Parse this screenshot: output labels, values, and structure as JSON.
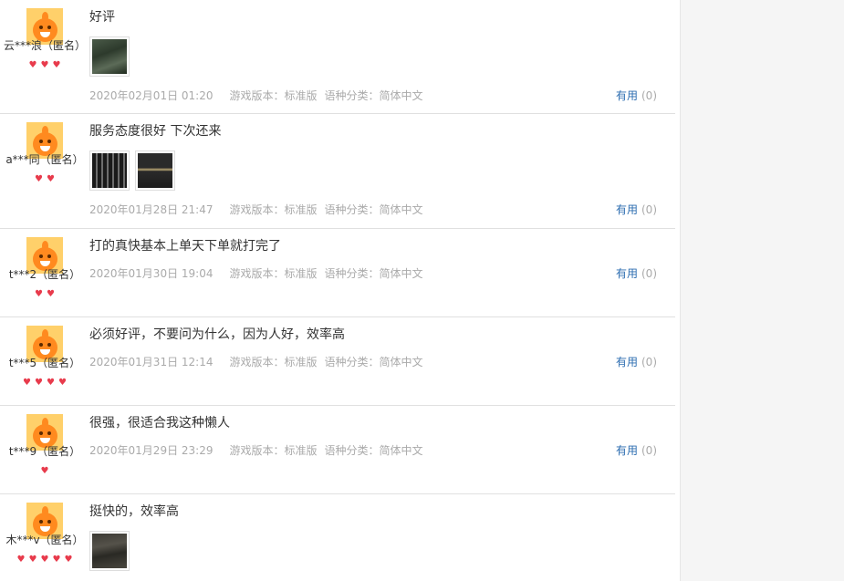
{
  "reviews": [
    {
      "username": "云***浪（匿名）",
      "gem_count": 3,
      "text": "好评",
      "images": [
        "dark-green"
      ],
      "date": "2020年02月01日 01:20",
      "version": "游戏版本：标准版",
      "language": "语种分类：简体中文",
      "useful_label": "有用",
      "useful_count": "(0)"
    },
    {
      "username": "a***同（匿名）",
      "gem_count": 2,
      "text": "服务态度很好 下次还来",
      "images": [
        "dark-grid",
        "dark-strip"
      ],
      "date": "2020年01月28日 21:47",
      "version": "游戏版本：标准版",
      "language": "语种分类：简体中文",
      "useful_label": "有用",
      "useful_count": "(0)"
    },
    {
      "username": "t***2（匿名）",
      "gem_count": 2,
      "text": "打的真快基本上单天下单就打完了",
      "images": [],
      "date": "2020年01月30日 19:04",
      "version": "游戏版本：标准版",
      "language": "语种分类：简体中文",
      "useful_label": "有用",
      "useful_count": "(0)"
    },
    {
      "username": "t***5（匿名）",
      "gem_count": 4,
      "text": "必须好评，不要问为什么，因为人好，效率高",
      "images": [],
      "date": "2020年01月31日 12:14",
      "version": "游戏版本：标准版",
      "language": "语种分类：简体中文",
      "useful_label": "有用",
      "useful_count": "(0)"
    },
    {
      "username": "t***9（匿名）",
      "gem_count": 1,
      "text": "很强，很适合我这种懒人",
      "images": [],
      "date": "2020年01月29日 23:29",
      "version": "游戏版本：标准版",
      "language": "语种分类：简体中文",
      "useful_label": "有用",
      "useful_count": "(0)"
    },
    {
      "username": "木***v（匿名）",
      "gem_count": 5,
      "text": "挺快的，效率高",
      "images": [
        "dark-scene"
      ],
      "date": "",
      "version": "",
      "language": "",
      "useful_label": "",
      "useful_count": ""
    }
  ],
  "colors": {
    "text": "#333333",
    "meta": "#aaaaaa",
    "link": "#2b6cb0",
    "gem": "#e83b4c",
    "avatar_bg": "#ffd06a",
    "avatar_body": "#ff8a1f"
  }
}
